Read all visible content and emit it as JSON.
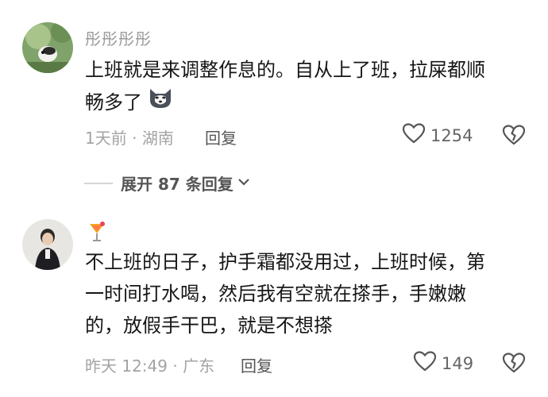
{
  "comments": [
    {
      "username": "彤彤彤彤",
      "text_line1": "上班就是来调整作息的。自从上了班，拉屎都顺",
      "text_line2": "畅多了",
      "time": "1天前",
      "location": "湖南",
      "reply_label": "回复",
      "likes": "1254",
      "replies_label": "展开 87 条回复"
    },
    {
      "text_line1": "不上班的日子，护手霜都没用过，上班时候，第",
      "text_line2": "一时间打水喝，然后我有空就在搽手，手嫩嫩",
      "text_line3": "的，放假手干巴，就是不想搽",
      "time": "昨天 12:49",
      "location": "广东",
      "reply_label": "回复",
      "likes": "149"
    }
  ]
}
